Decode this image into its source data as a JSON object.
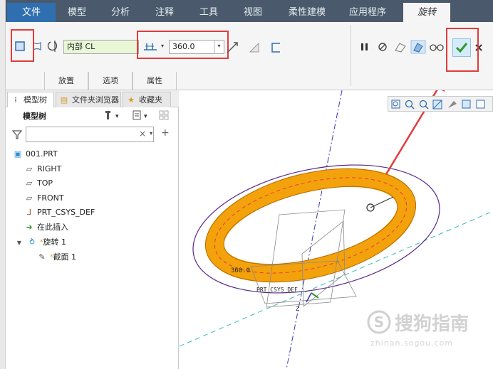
{
  "ribbon_tabs": [
    "文件",
    "模型",
    "分析",
    "注释",
    "工具",
    "视图",
    "柔性建模",
    "应用程序",
    "旋转"
  ],
  "ribbon": {
    "sketch_ref_value": "内部 CL",
    "angle_value": "360.0"
  },
  "sub_tabs": [
    "放置",
    "选项",
    "属性"
  ],
  "panel_tabs": [
    "模型树",
    "文件夹浏览器",
    "收藏夹"
  ],
  "tree": {
    "header": "模型树",
    "items": [
      "001.PRT",
      "RIGHT",
      "TOP",
      "FRONT",
      "PRT_CSYS_DEF",
      "在此插入",
      "旋转 1",
      "截面 1"
    ]
  },
  "viewport": {
    "angle_label": "360.0",
    "csys_label": "PRT_CSYS_DEF",
    "axis_z": "Z"
  },
  "watermark": {
    "brand": "搜狗指南",
    "url": "zhinan.sogou.com"
  },
  "colors": {
    "torus": "#f3a20c",
    "highlight": "#e23b3b",
    "file_tab": "#2f6fb0",
    "tab_bar": "#4a5a6c"
  }
}
